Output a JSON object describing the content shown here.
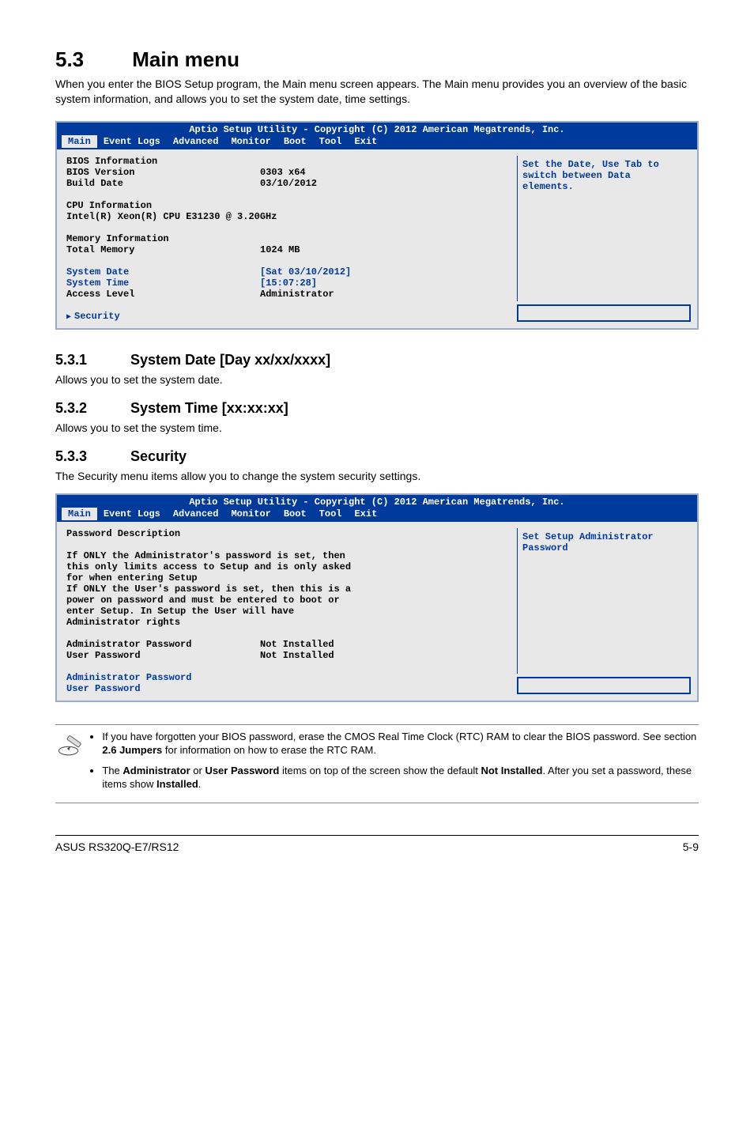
{
  "page": {
    "section_num": "5.3",
    "section_title": "Main menu",
    "intro": "When you enter the BIOS Setup program, the Main menu screen appears. The Main menu provides you an overview of the basic system information, and allows you to set the system date, time settings."
  },
  "bios1": {
    "header_title": "Aptio Setup Utility - Copyright (C) 2012 American Megatrends, Inc.",
    "tabs": [
      "Main",
      "Event Logs",
      "Advanced",
      "Monitor",
      "Boot",
      "Tool",
      "Exit"
    ],
    "active_tab": "Main",
    "help": "Set the Date, Use Tab to switch between Data elements.",
    "lines": {
      "bios_info_hdr": "BIOS Information",
      "ver_lbl": "BIOS Version",
      "ver_val": "0303 x64",
      "bd_lbl": "Build Date",
      "bd_val": "03/10/2012",
      "cpu_hdr": "CPU Information",
      "cpu_line": "Intel(R) Xeon(R) CPU E31230 @ 3.20GHz",
      "mem_hdr": "Memory Information",
      "mem_lbl": "Total Memory",
      "mem_val": "1024 MB",
      "date_lbl": "System Date",
      "date_val": "[Sat 03/10/2012]",
      "time_lbl": "System Time",
      "time_val": "[15:07:28]",
      "acc_lbl": "Access Level",
      "acc_val": "Administrator",
      "sec": "Security"
    }
  },
  "s1": {
    "num": "5.3.1",
    "title": "System Date [Day xx/xx/xxxx]",
    "body": "Allows you to set the system date."
  },
  "s2": {
    "num": "5.3.2",
    "title": "System Time [xx:xx:xx]",
    "body": "Allows you to set the system time."
  },
  "s3": {
    "num": "5.3.3",
    "title": "Security",
    "body": "The Security menu items allow you to change the system security settings."
  },
  "bios2": {
    "header_title": "Aptio Setup Utility - Copyright (C) 2012 American Megatrends, Inc.",
    "tabs": [
      "Main",
      "Event Logs",
      "Advanced",
      "Monitor",
      "Boot",
      "Tool",
      "Exit"
    ],
    "active_tab": "Main",
    "help": "Set Setup Administrator Password",
    "lines": {
      "pd_hdr": "Password Description",
      "desc": "If ONLY the Administrator's password is set, then this only limits access to Setup and is only asked for when entering Setup\nIf ONLY the User's password is set, then this is a power on password and must be entered to boot or enter Setup. In Setup the User will have Administrator rights",
      "ap_lbl": "Administrator Password",
      "ap_val": "Not Installed",
      "up_lbl": "User Password",
      "up_val": "Not Installed",
      "ap_link": "Administrator Password",
      "up_link": "User Password"
    }
  },
  "notes": {
    "n1_a": "If you have forgotten your BIOS password, erase the CMOS Real Time Clock (RTC) RAM to clear the BIOS password. See section ",
    "n1_b": "2.6 Jumpers",
    "n1_c": " for information on how to erase the RTC RAM.",
    "n2_a": "The ",
    "n2_b": "Administrator",
    "n2_c": " or ",
    "n2_d": "User Password",
    "n2_e": " items on top of the screen show the default ",
    "n2_f": "Not Installed",
    "n2_g": ". After you set a password, these items show ",
    "n2_h": "Installed",
    "n2_i": "."
  },
  "footer": {
    "left": "ASUS RS320Q-E7/RS12",
    "right": "5-9"
  }
}
